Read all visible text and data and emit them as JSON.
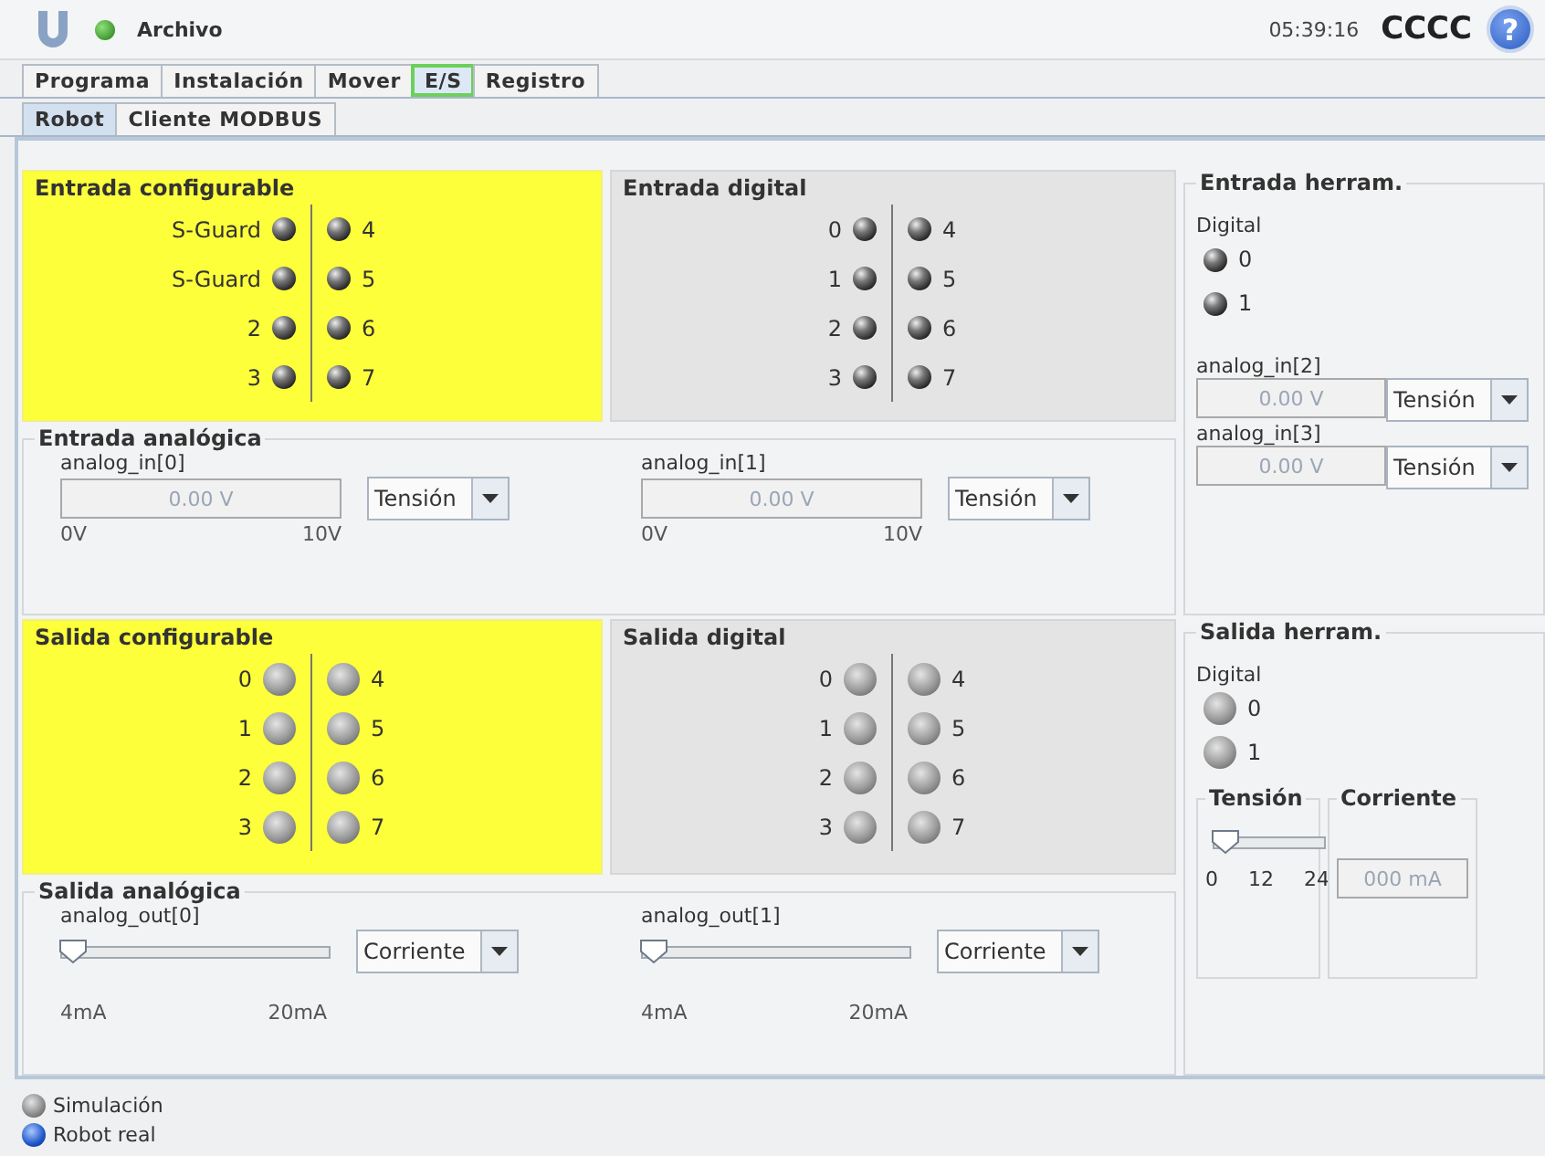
{
  "header": {
    "status_on": true,
    "title": "Archivo",
    "time": "05:39:16",
    "robot_name": "CCCC",
    "help_glyph": "?"
  },
  "tabs": [
    {
      "label": "Programa",
      "selected": false
    },
    {
      "label": "Instalación",
      "selected": false
    },
    {
      "label": "Mover",
      "selected": false
    },
    {
      "label": "E/S",
      "selected": true
    },
    {
      "label": "Registro",
      "selected": false
    }
  ],
  "subtabs": [
    {
      "label": "Robot",
      "selected": true
    },
    {
      "label": "Cliente MODBUS",
      "selected": false
    }
  ],
  "input_groups": [
    {
      "title": "Entrada configurable",
      "highlighted": true,
      "kind": "input",
      "leds": [
        {
          "label": "S-Guard",
          "on": false
        },
        {
          "label": "S-Guard",
          "on": false
        },
        {
          "label": "2",
          "on": false
        },
        {
          "label": "3",
          "on": false
        },
        {
          "label": "4",
          "on": false
        },
        {
          "label": "5",
          "on": false
        },
        {
          "label": "6",
          "on": false
        },
        {
          "label": "7",
          "on": false
        }
      ]
    },
    {
      "title": "Entrada digital",
      "highlighted": false,
      "kind": "input",
      "leds": [
        {
          "label": "0",
          "on": false
        },
        {
          "label": "1",
          "on": false
        },
        {
          "label": "2",
          "on": false
        },
        {
          "label": "3",
          "on": false
        },
        {
          "label": "4",
          "on": false
        },
        {
          "label": "5",
          "on": false
        },
        {
          "label": "6",
          "on": false
        },
        {
          "label": "7",
          "on": false
        }
      ]
    }
  ],
  "analog_inputs": {
    "title": "Entrada analógica",
    "channels": [
      {
        "name": "analog_in[0]",
        "value": "0.00 V",
        "mode": "Tensión",
        "min": "0V",
        "max": "10V"
      },
      {
        "name": "analog_in[1]",
        "value": "0.00 V",
        "mode": "Tensión",
        "min": "0V",
        "max": "10V"
      }
    ]
  },
  "tool_input": {
    "title": "Entrada herram.",
    "digital_label": "Digital",
    "kind": "input",
    "leds": [
      {
        "label": "0",
        "on": false
      },
      {
        "label": "1",
        "on": false
      }
    ],
    "analog": [
      {
        "name": "analog_in[2]",
        "value": "0.00 V",
        "mode": "Tensión"
      },
      {
        "name": "analog_in[3]",
        "value": "0.00 V",
        "mode": "Tensión"
      }
    ]
  },
  "output_groups": [
    {
      "title": "Salida configurable",
      "highlighted": true,
      "kind": "output",
      "leds": [
        {
          "label": "0",
          "on": false
        },
        {
          "label": "1",
          "on": false
        },
        {
          "label": "2",
          "on": false
        },
        {
          "label": "3",
          "on": false
        },
        {
          "label": "4",
          "on": false
        },
        {
          "label": "5",
          "on": false
        },
        {
          "label": "6",
          "on": false
        },
        {
          "label": "7",
          "on": false
        }
      ]
    },
    {
      "title": "Salida digital",
      "highlighted": false,
      "kind": "output",
      "leds": [
        {
          "label": "0",
          "on": false
        },
        {
          "label": "1",
          "on": false
        },
        {
          "label": "2",
          "on": false
        },
        {
          "label": "3",
          "on": false
        },
        {
          "label": "4",
          "on": false
        },
        {
          "label": "5",
          "on": false
        },
        {
          "label": "6",
          "on": false
        },
        {
          "label": "7",
          "on": false
        }
      ]
    }
  ],
  "analog_outputs": {
    "title": "Salida analógica",
    "channels": [
      {
        "name": "analog_out[0]",
        "level": 0,
        "mode": "Corriente",
        "min": "4mA",
        "max": "20mA"
      },
      {
        "name": "analog_out[1]",
        "level": 0,
        "mode": "Corriente",
        "min": "4mA",
        "max": "20mA"
      }
    ]
  },
  "tool_output": {
    "title": "Salida herram.",
    "digital_label": "Digital",
    "kind": "output",
    "leds": [
      {
        "label": "0",
        "on": false
      },
      {
        "label": "1",
        "on": false
      }
    ],
    "voltage": {
      "title": "Tensión",
      "level": 0,
      "ticks": [
        "0",
        "12",
        "24"
      ]
    },
    "current": {
      "title": "Corriente",
      "value": "000 mA"
    }
  },
  "legend": [
    {
      "label": "Simulación",
      "selected": false
    },
    {
      "label": "Robot real",
      "selected": true
    }
  ]
}
